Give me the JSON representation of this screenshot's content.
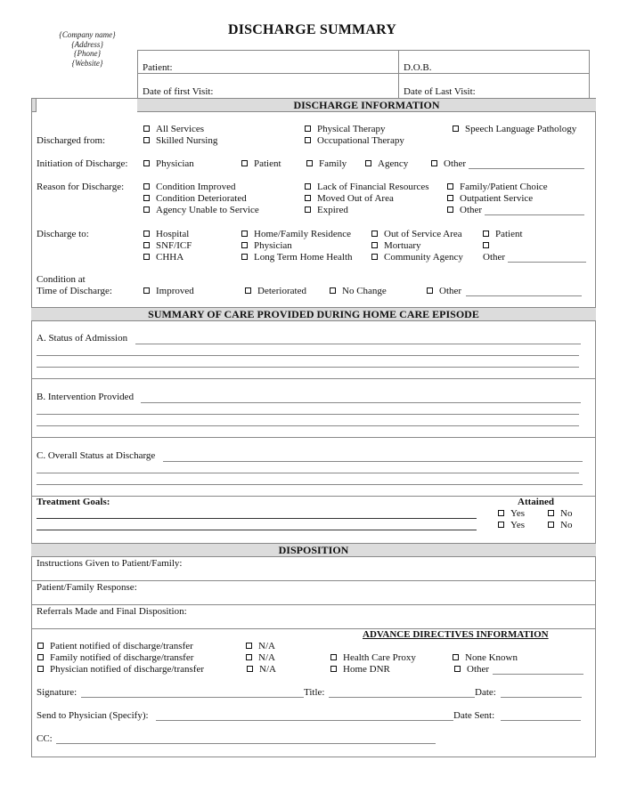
{
  "header": {
    "company": [
      "{Company name}",
      "{Address}",
      "{Phone}",
      "{Website}"
    ],
    "title": "DISCHARGE SUMMARY",
    "patient_label": "Patient:",
    "dob_label": "D.O.B.",
    "first_visit_label": "Date of first Visit:",
    "last_visit_label": "Date of Last Visit:"
  },
  "discharge_info": {
    "heading": "DISCHARGE INFORMATION",
    "discharged_from": {
      "label": "Discharged from:",
      "options": [
        "All Services",
        "Skilled Nursing",
        "Physical Therapy",
        "Occupational Therapy",
        "Speech Language Pathology"
      ]
    },
    "initiation": {
      "label": "Initiation of Discharge:",
      "options": [
        "Physician",
        "Patient",
        "Family",
        "Agency",
        "Other"
      ]
    },
    "reason": {
      "label": "Reason for Discharge:",
      "options": [
        "Condition Improved",
        "Condition Deteriorated",
        "Agency Unable to Service",
        "Lack of Financial Resources",
        "Moved Out of Area",
        "Expired",
        "Family/Patient Choice",
        "Outpatient Service",
        "Other"
      ]
    },
    "discharge_to": {
      "label": "Discharge to:",
      "options": [
        "Hospital",
        "SNF/ICF",
        "CHHA",
        "Home/Family Residence",
        "Physician",
        "Long Term Home Health",
        "Out of Service Area",
        "Mortuary",
        "Community Agency",
        "Patient",
        "Other"
      ]
    },
    "condition": {
      "label_line1": "Condition at",
      "label_line2": "Time of Discharge:",
      "options": [
        "Improved",
        "Deteriorated",
        "No Change",
        "Other"
      ]
    }
  },
  "summary_of_care": {
    "heading": "SUMMARY OF CARE PROVIDED DURING HOME CARE EPISODE",
    "a_label": "A. Status of Admission",
    "b_label": "B. Intervention Provided",
    "c_label": "C. Overall Status at Discharge",
    "treatment_goals_label": "Treatment Goals:",
    "attained_label": "Attained",
    "yes_label": "Yes",
    "no_label": "No"
  },
  "disposition": {
    "heading": "DISPOSITION",
    "instructions_label": "Instructions Given to Patient/Family:",
    "response_label": "Patient/Family Response:",
    "referrals_label": "Referrals Made and Final Disposition:",
    "notifications": [
      "Patient notified of discharge/transfer",
      "Family notified of discharge/transfer",
      "Physician notified of discharge/transfer"
    ],
    "na_label": "N/A",
    "advance_heading": "ADVANCE DIRECTIVES INFORMATION",
    "advance_options": [
      "Health Care Proxy",
      "Home DNR",
      "None Known",
      "Other"
    ],
    "signature_label": "Signature:",
    "title_label": "Title:",
    "date_label": "Date:",
    "send_label": "Send to Physician (Specify):",
    "date_sent_label": "Date Sent:",
    "cc_label": "CC:"
  }
}
